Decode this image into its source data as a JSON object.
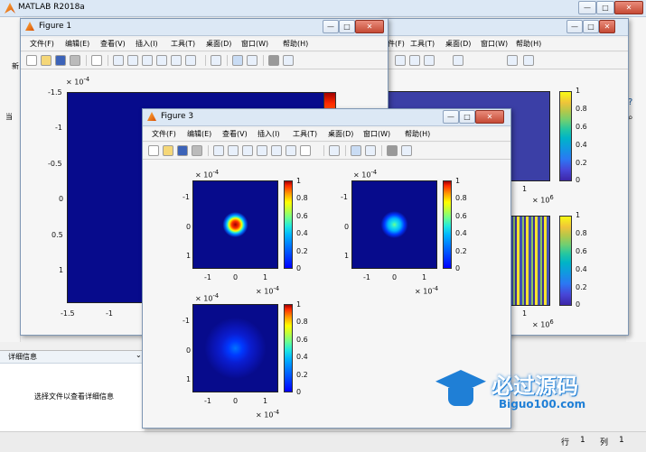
{
  "app": {
    "title": "MATLAB R2018a",
    "status": {
      "label1": "行",
      "value1": "1",
      "label2": "列",
      "value2": "1"
    }
  },
  "left_panel": {
    "detail_label": "详细信息",
    "hint": "选择文件以查看详细信息",
    "clipped_label": "当",
    "clipped_label2": "新"
  },
  "menus": [
    "文件(F)",
    "编辑(E)",
    "查看(V)",
    "插入(I)",
    "工具(T)",
    "桌面(D)",
    "窗口(W)",
    "帮助(H)"
  ],
  "figure1": {
    "title": "Figure 1",
    "exp": "× 10",
    "exp_power": "-4",
    "y_ticks": [
      "-1.5",
      "-1",
      "-0.5",
      "0",
      "0.5",
      "1"
    ],
    "x_ticks": [
      "-1.5",
      "-1"
    ]
  },
  "figure2": {
    "exp": "× 10",
    "exp_power": "6",
    "tick": "1",
    "cb_ticks": [
      "1",
      "0.8",
      "0.6",
      "0.4",
      "0.2",
      "0"
    ]
  },
  "figure3": {
    "title": "Figure 3",
    "exp": "× 10",
    "exp_power": "-4",
    "cb_ticks": [
      "1",
      "0.8",
      "0.6",
      "0.4",
      "0.2",
      "0"
    ],
    "y_ticks": [
      "-1",
      "0",
      "1"
    ],
    "x_ticks": [
      "-1",
      "0",
      "1"
    ]
  },
  "watermark": {
    "title": "必过源码",
    "url": "Biguo100.com"
  }
}
